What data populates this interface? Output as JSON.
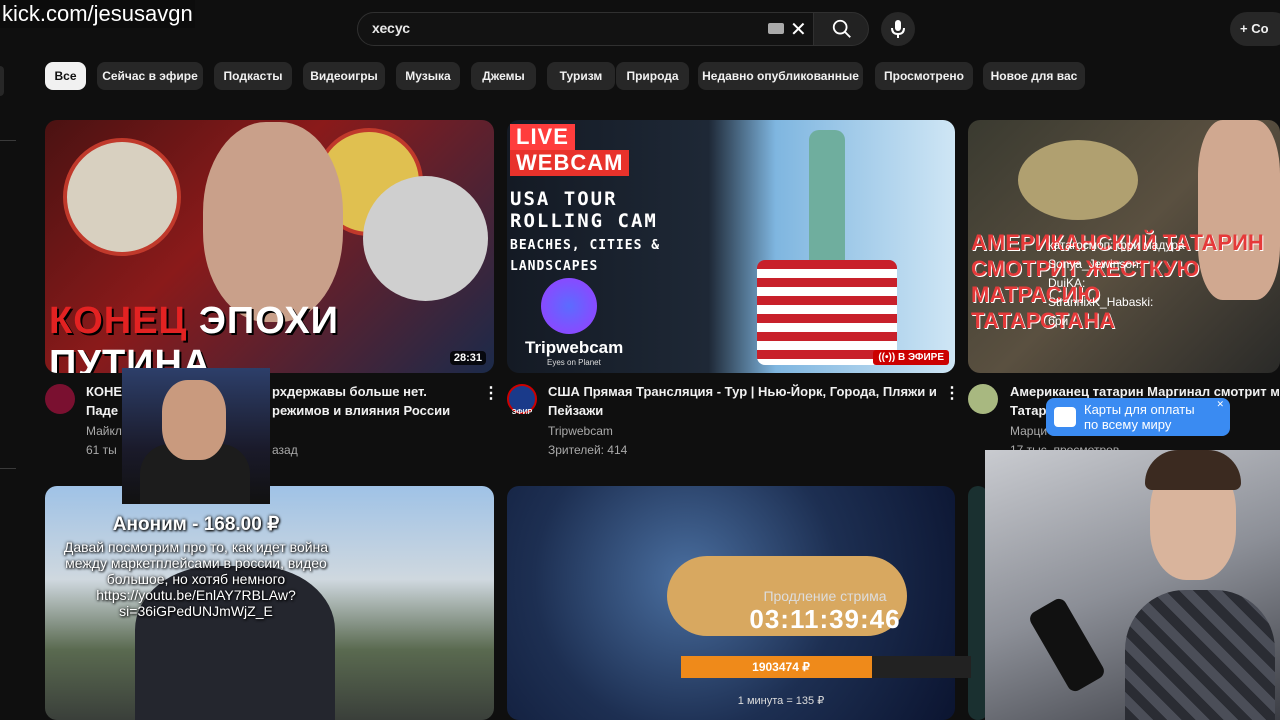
{
  "watermark": "kick.com/jesusavgn",
  "search": {
    "query": "хесус",
    "clear_icon": "close-icon",
    "button_icon": "search-icon",
    "mic_icon": "mic-icon"
  },
  "create_button": "+ Со",
  "chips": [
    "Все",
    "Сейчас в эфире",
    "Подкасты",
    "Видеоигры",
    "Музыка",
    "Джемы",
    "Туризм",
    "Природа",
    "Недавно опубликованные",
    "Просмотрено",
    "Новое для вас"
  ],
  "videos": [
    {
      "thumb_text_red": "КОНЕЦ",
      "thumb_text_white": "ЭПОХИ ПУТИНА",
      "duration": "28:31",
      "title_line1": "КОНЕ",
      "title_line1b": "рхдержавы больше нет.",
      "title_line2": "Паде",
      "title_line2b": "режимов и влияния России",
      "channel": "Майкл",
      "stats": "61 ты",
      "stats_b": "азад"
    },
    {
      "live_line1": "LIVE",
      "live_line2": "WEBCAM",
      "usa_line1": "USA TOUR",
      "usa_line2": "ROLLING CAM",
      "usa_line3": "BEACHES, CITIES &",
      "usa_line4": "LANDSCAPES",
      "brand": "Tripwebcam",
      "brand_sub": "Eyes on Planet",
      "live_badge": "В ЭФИРЕ",
      "title_line1": "США Прямая Трансляция - Тур | Нью-Йорк, Города, Пляжи и",
      "title_line2": "Пейзажи",
      "channel": "Tripwebcam",
      "stats": "Зрителей: 414",
      "avatar_label": "ЭФИР"
    },
    {
      "thumb_lines": [
        "АМЕРИКАНСКИЙ ТАТАРИН",
        "СМОТРИТ ЖЕСТКУЮ",
        "МАТРАСИЮ",
        "ТАТАРСТАНА"
      ],
      "title_line1": "Американец татарин Маргинал смотрит м",
      "title_line2": "Татар",
      "channel": "Марци",
      "stats": "17 тыс. просмотров"
    }
  ],
  "chat_overlay": [
    "катагосмоп: фри мадура",
    "Sonya_Jewinson:",
    "DuiKA:",
    "StrannixK_Habaski:",
    "бри"
  ],
  "donation": {
    "header": "Аноним - 168.00 ₽",
    "message": "Давай посмотрим про то, как идет война между маркетплейсами в россии, видео большое, но хотяб немного https://youtu.be/EnlAY7RBLAw?si=36iGPedUNJmWjZ_E"
  },
  "stream_extension": {
    "label": "Продление стрима",
    "timer": "03:11:39:46",
    "amount": "1903474 ₽",
    "progress": 0.66,
    "rate": "1 минута = 135 ₽"
  },
  "pay_banner": {
    "line1": "Карты для оплаты",
    "line2": "по всему миру",
    "close": "✕"
  },
  "colors": {
    "background": "#0f0f0f",
    "chip_bg": "#272727",
    "chip_active_bg": "#f1f1f1",
    "live_red": "#cc0000",
    "progress_orange": "#ef8a1a",
    "pay_blue": "#3a8bf2"
  }
}
